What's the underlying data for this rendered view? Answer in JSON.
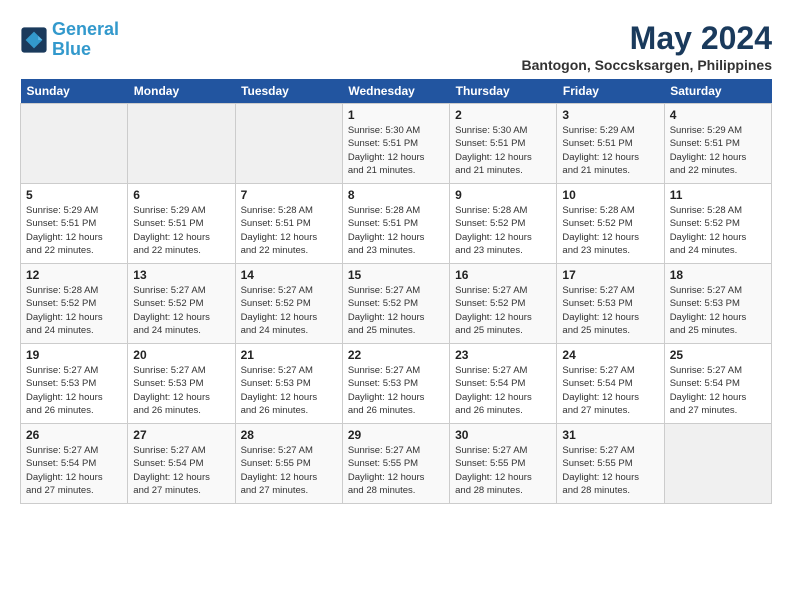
{
  "header": {
    "logo_line1": "General",
    "logo_line2": "Blue",
    "month_year": "May 2024",
    "location": "Bantogon, Soccsksargen, Philippines"
  },
  "days_of_week": [
    "Sunday",
    "Monday",
    "Tuesday",
    "Wednesday",
    "Thursday",
    "Friday",
    "Saturday"
  ],
  "weeks": [
    [
      {
        "day": "",
        "info": ""
      },
      {
        "day": "",
        "info": ""
      },
      {
        "day": "",
        "info": ""
      },
      {
        "day": "1",
        "info": "Sunrise: 5:30 AM\nSunset: 5:51 PM\nDaylight: 12 hours\nand 21 minutes."
      },
      {
        "day": "2",
        "info": "Sunrise: 5:30 AM\nSunset: 5:51 PM\nDaylight: 12 hours\nand 21 minutes."
      },
      {
        "day": "3",
        "info": "Sunrise: 5:29 AM\nSunset: 5:51 PM\nDaylight: 12 hours\nand 21 minutes."
      },
      {
        "day": "4",
        "info": "Sunrise: 5:29 AM\nSunset: 5:51 PM\nDaylight: 12 hours\nand 22 minutes."
      }
    ],
    [
      {
        "day": "5",
        "info": "Sunrise: 5:29 AM\nSunset: 5:51 PM\nDaylight: 12 hours\nand 22 minutes."
      },
      {
        "day": "6",
        "info": "Sunrise: 5:29 AM\nSunset: 5:51 PM\nDaylight: 12 hours\nand 22 minutes."
      },
      {
        "day": "7",
        "info": "Sunrise: 5:28 AM\nSunset: 5:51 PM\nDaylight: 12 hours\nand 22 minutes."
      },
      {
        "day": "8",
        "info": "Sunrise: 5:28 AM\nSunset: 5:51 PM\nDaylight: 12 hours\nand 23 minutes."
      },
      {
        "day": "9",
        "info": "Sunrise: 5:28 AM\nSunset: 5:52 PM\nDaylight: 12 hours\nand 23 minutes."
      },
      {
        "day": "10",
        "info": "Sunrise: 5:28 AM\nSunset: 5:52 PM\nDaylight: 12 hours\nand 23 minutes."
      },
      {
        "day": "11",
        "info": "Sunrise: 5:28 AM\nSunset: 5:52 PM\nDaylight: 12 hours\nand 24 minutes."
      }
    ],
    [
      {
        "day": "12",
        "info": "Sunrise: 5:28 AM\nSunset: 5:52 PM\nDaylight: 12 hours\nand 24 minutes."
      },
      {
        "day": "13",
        "info": "Sunrise: 5:27 AM\nSunset: 5:52 PM\nDaylight: 12 hours\nand 24 minutes."
      },
      {
        "day": "14",
        "info": "Sunrise: 5:27 AM\nSunset: 5:52 PM\nDaylight: 12 hours\nand 24 minutes."
      },
      {
        "day": "15",
        "info": "Sunrise: 5:27 AM\nSunset: 5:52 PM\nDaylight: 12 hours\nand 25 minutes."
      },
      {
        "day": "16",
        "info": "Sunrise: 5:27 AM\nSunset: 5:52 PM\nDaylight: 12 hours\nand 25 minutes."
      },
      {
        "day": "17",
        "info": "Sunrise: 5:27 AM\nSunset: 5:53 PM\nDaylight: 12 hours\nand 25 minutes."
      },
      {
        "day": "18",
        "info": "Sunrise: 5:27 AM\nSunset: 5:53 PM\nDaylight: 12 hours\nand 25 minutes."
      }
    ],
    [
      {
        "day": "19",
        "info": "Sunrise: 5:27 AM\nSunset: 5:53 PM\nDaylight: 12 hours\nand 26 minutes."
      },
      {
        "day": "20",
        "info": "Sunrise: 5:27 AM\nSunset: 5:53 PM\nDaylight: 12 hours\nand 26 minutes."
      },
      {
        "day": "21",
        "info": "Sunrise: 5:27 AM\nSunset: 5:53 PM\nDaylight: 12 hours\nand 26 minutes."
      },
      {
        "day": "22",
        "info": "Sunrise: 5:27 AM\nSunset: 5:53 PM\nDaylight: 12 hours\nand 26 minutes."
      },
      {
        "day": "23",
        "info": "Sunrise: 5:27 AM\nSunset: 5:54 PM\nDaylight: 12 hours\nand 26 minutes."
      },
      {
        "day": "24",
        "info": "Sunrise: 5:27 AM\nSunset: 5:54 PM\nDaylight: 12 hours\nand 27 minutes."
      },
      {
        "day": "25",
        "info": "Sunrise: 5:27 AM\nSunset: 5:54 PM\nDaylight: 12 hours\nand 27 minutes."
      }
    ],
    [
      {
        "day": "26",
        "info": "Sunrise: 5:27 AM\nSunset: 5:54 PM\nDaylight: 12 hours\nand 27 minutes."
      },
      {
        "day": "27",
        "info": "Sunrise: 5:27 AM\nSunset: 5:54 PM\nDaylight: 12 hours\nand 27 minutes."
      },
      {
        "day": "28",
        "info": "Sunrise: 5:27 AM\nSunset: 5:55 PM\nDaylight: 12 hours\nand 27 minutes."
      },
      {
        "day": "29",
        "info": "Sunrise: 5:27 AM\nSunset: 5:55 PM\nDaylight: 12 hours\nand 28 minutes."
      },
      {
        "day": "30",
        "info": "Sunrise: 5:27 AM\nSunset: 5:55 PM\nDaylight: 12 hours\nand 28 minutes."
      },
      {
        "day": "31",
        "info": "Sunrise: 5:27 AM\nSunset: 5:55 PM\nDaylight: 12 hours\nand 28 minutes."
      },
      {
        "day": "",
        "info": ""
      }
    ]
  ]
}
